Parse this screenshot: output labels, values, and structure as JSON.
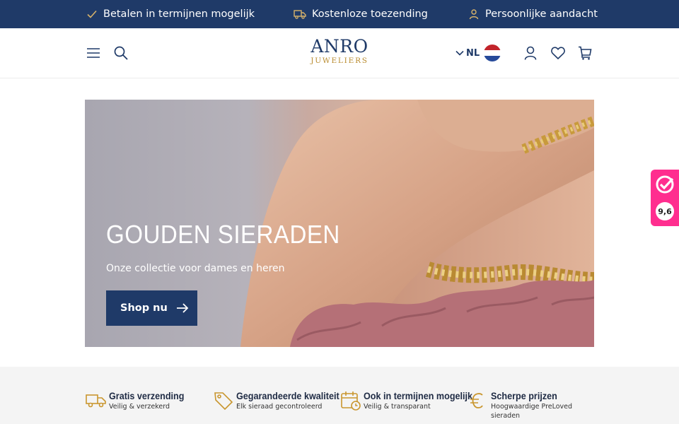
{
  "topbar": {
    "usps": [
      {
        "icon": "check-icon",
        "label": "Betalen in termijnen mogelijk"
      },
      {
        "icon": "truck-icon",
        "label": "Kostenloze toezending"
      },
      {
        "icon": "person-icon",
        "label": "Persoonlijke aandacht"
      }
    ]
  },
  "header": {
    "logo_main": "ANRO",
    "logo_sub": "JUWELIERS",
    "language": "NL",
    "icons": [
      "menu-icon",
      "search-icon",
      "account-icon",
      "heart-icon",
      "cart-icon"
    ]
  },
  "hero": {
    "title": "GOUDEN SIERADEN",
    "subtitle": "Onze collectie voor dames en heren",
    "cta": "Shop nu"
  },
  "features": [
    {
      "icon": "truck-icon",
      "title": "Gratis verzending",
      "subtitle": "Veilig & verzekerd"
    },
    {
      "icon": "tag-icon",
      "title": "Gegarandeerde kwaliteit",
      "subtitle": "Elk sieraad gecontroleerd"
    },
    {
      "icon": "calendar-icon",
      "title": "Ook in termijnen mogelijk",
      "subtitle": "Veilig & transparant"
    },
    {
      "icon": "euro-icon",
      "title": "Scherpe prijzen",
      "subtitle": "Hoogwaardige PreLoved sieraden"
    }
  ],
  "rating_badge": {
    "score": "9,6"
  },
  "colors": {
    "brand_navy": "#1f3a68",
    "gold": "#b88a2c",
    "badge_pink": "#ff2e8f"
  }
}
